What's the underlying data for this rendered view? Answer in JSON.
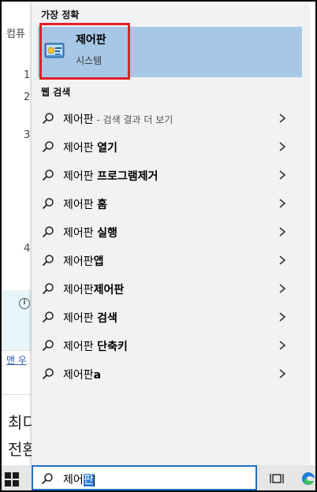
{
  "background_page": {
    "header_fragment": "컴퓨",
    "numbers": [
      "1",
      "2",
      "3",
      "4"
    ],
    "link_fragment": "맨 우",
    "big_line_1": "최디",
    "big_line_2": "전환"
  },
  "search_panel": {
    "best_match_heading": "가장 정확",
    "best_match": {
      "title": "제어판",
      "subtitle": "시스템",
      "icon": "control-panel-icon"
    },
    "web_heading": "웹 검색",
    "web_results": [
      {
        "query": "제어판",
        "suffix": " - 검색 결과 더 보기"
      },
      {
        "query": "제어판 ",
        "bold": "열기"
      },
      {
        "query": "제어판 ",
        "bold": "프로그램제거"
      },
      {
        "query": "제어판 ",
        "bold": "홈"
      },
      {
        "query": "제어판 ",
        "bold": "실행"
      },
      {
        "query": "제어판",
        "bold": "앱"
      },
      {
        "query": "제어판",
        "bold": "제어판"
      },
      {
        "query": "제어판 ",
        "bold": "검색"
      },
      {
        "query": "제어판 ",
        "bold": "단축키"
      },
      {
        "query": "제어판",
        "bold": "a"
      }
    ]
  },
  "taskbar": {
    "search_typed": "제어",
    "search_selected": "판",
    "icons": [
      "windows-start-icon",
      "task-view-icon",
      "edge-icon"
    ]
  },
  "colors": {
    "panel_bg": "#f2f2f2",
    "best_match_bg": "#a7c7e6",
    "highlight_border": "#e0202a",
    "search_border": "#1f6fbd"
  }
}
